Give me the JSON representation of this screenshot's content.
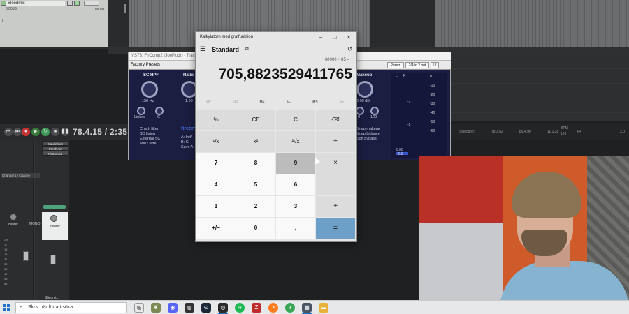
{
  "daw": {
    "track_name": "Slöedmix",
    "track_volume": "0.00dB",
    "track_pan": "center",
    "track_number": "1",
    "transport_time": "78.4.15 / 2:35.5",
    "status": {
      "selection_label": "Selection:",
      "selection_start": "78.3.62",
      "selection_end": "89.4.90",
      "selection_length": "11.1.28",
      "bpm_label": "BPM",
      "bpm_value": "120",
      "time_sig": "4/4",
      "rate": "2.0"
    },
    "mixer": {
      "fx_slots": [
        "Blauiterium",
        "Fresh Air",
        "FirComp2"
      ],
      "channel_label": "Channel 1 / Channe",
      "strip_label": "center",
      "master_label": "center",
      "strip_name": "Sliedmix",
      "mono": "MONO",
      "scale": [
        "-inf",
        "-inf",
        "-6",
        "-6",
        "12",
        "18",
        "24",
        "30",
        "36",
        "42",
        "48",
        "54"
      ]
    }
  },
  "plugin": {
    "title": "VST3: FirComp2 (JoéP.odr) - Track 1 \"S",
    "preset": "Factory Presets",
    "buttons": [
      "Param",
      "2/4 in 2 out",
      "UI"
    ],
    "sc_hpf_label": "SC HPF",
    "sc_hpf_value": "150 Hz",
    "ratio_label": "Ratio",
    "ratio_value": "1.50",
    "linked_label": "Linked",
    "c_label": "C",
    "options_left": [
      "Crush filter",
      "SC listen",
      "External SC",
      "Mid / side"
    ],
    "brand": "fircom",
    "brand_lines": [
      "A: Init*",
      "B: C",
      "Save A"
    ],
    "makeup_label": "Makeup",
    "makeup_value": "0.00 dB",
    "makeup_small": [
      "0",
      "100"
    ],
    "options_right": [
      "Snap makeup",
      "Snap balance",
      "Soft bypass"
    ],
    "meter_header": [
      "L",
      "R"
    ],
    "meter_scale": [
      "-1",
      "-2"
    ],
    "meter_readout": [
      "0.00",
      "0.0"
    ],
    "ratio_scale": [
      "0",
      "-10",
      "-20",
      "-30",
      "-40",
      "-50",
      "-60"
    ]
  },
  "calculator": {
    "window_title": "Kalkylatorn med graffunktion",
    "mode": "Standard",
    "expression": "60000 ÷ 85 =",
    "display": "705,8823529411765",
    "memory_buttons": [
      "MC",
      "MR",
      "M+",
      "M-",
      "MS",
      "M˅"
    ],
    "keys": [
      [
        "%",
        "CE",
        "C",
        "⌫"
      ],
      [
        "¹/x",
        "x²",
        "²√x",
        "÷"
      ],
      [
        "7",
        "8",
        "9",
        "×"
      ],
      [
        "4",
        "5",
        "6",
        "−"
      ],
      [
        "1",
        "2",
        "3",
        "+"
      ],
      [
        "+/−",
        "0",
        ",",
        "="
      ]
    ]
  },
  "taskbar": {
    "search_placeholder": "Skriv här för att söka",
    "apps": [
      "taskview",
      "discord",
      "obs",
      "steam",
      "reaper",
      "spotify",
      "filezilla",
      "firefox",
      "chrome",
      "calculator",
      "explorer"
    ]
  },
  "colors": {
    "accent": "#6da0c8",
    "daw_bg": "#1f2022",
    "plugin_bg": "#1b1e40",
    "taskbar": "#e7e8ea"
  }
}
